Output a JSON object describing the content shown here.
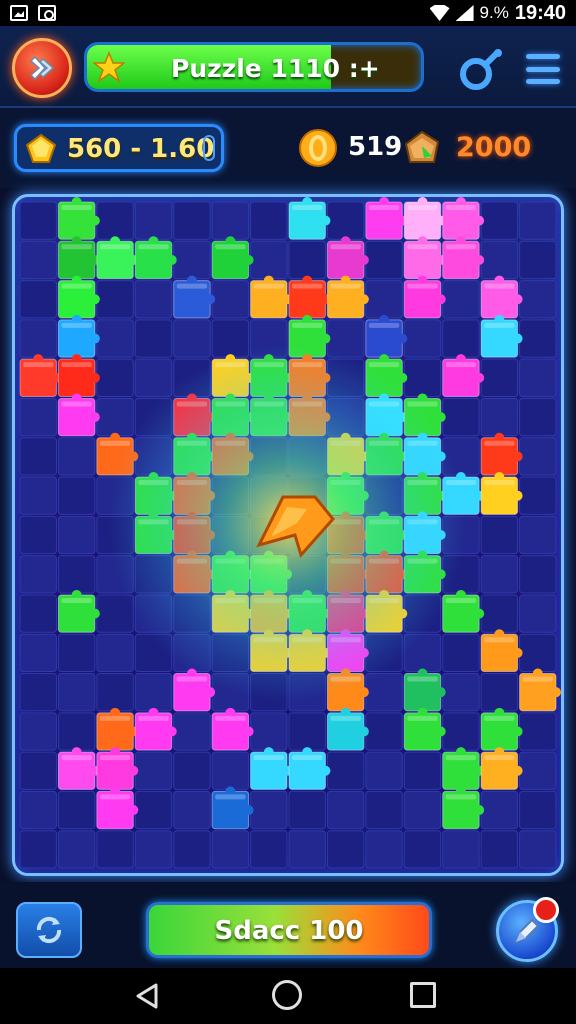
{
  "status_bar": {
    "battery_text": "9.%",
    "time": "19:40",
    "icons": [
      "photo-notification-icon",
      "app-notification-icon",
      "wifi-icon",
      "signal-icon"
    ]
  },
  "top_bar": {
    "level_title": "Puzzle 1110 :+",
    "level_progress": 0.73,
    "icons": [
      "close-icon",
      "star-icon",
      "gender-icon",
      "menu-icon"
    ]
  },
  "currency": {
    "gems_text": "560 - 1.60",
    "coins_text": "519",
    "chest_text": "2000",
    "icons": [
      "gem-icon",
      "coin-icon",
      "chest-icon"
    ]
  },
  "board": {
    "cols": 14,
    "rows": 17,
    "center_icon": "arrow-icon",
    "pieces": [
      [
        1,
        0,
        "#35e23a"
      ],
      [
        7,
        0,
        "#2fe0f0"
      ],
      [
        9,
        0,
        "#ff3df0"
      ],
      [
        10,
        0,
        "#ffb0f8"
      ],
      [
        11,
        0,
        "#ff5ae8"
      ],
      [
        1,
        1,
        "#22c433"
      ],
      [
        2,
        1,
        "#3af25a"
      ],
      [
        3,
        1,
        "#27e04a"
      ],
      [
        5,
        1,
        "#1fd23a"
      ],
      [
        8,
        1,
        "#e83ad0"
      ],
      [
        10,
        1,
        "#ff6ae8"
      ],
      [
        11,
        1,
        "#ff4ae0"
      ],
      [
        1,
        2,
        "#2af03a"
      ],
      [
        4,
        2,
        "#2b5bd8"
      ],
      [
        6,
        2,
        "#ffb020"
      ],
      [
        7,
        2,
        "#ff3a1a"
      ],
      [
        8,
        2,
        "#ffb020"
      ],
      [
        10,
        2,
        "#ff3ae0"
      ],
      [
        12,
        2,
        "#ff5ae8"
      ],
      [
        1,
        3,
        "#1fa8ff"
      ],
      [
        7,
        3,
        "#2fe03a"
      ],
      [
        9,
        3,
        "#2a4ad0"
      ],
      [
        12,
        3,
        "#35d8ff"
      ],
      [
        0,
        4,
        "#ff3a2a"
      ],
      [
        1,
        4,
        "#ff2a1a"
      ],
      [
        5,
        4,
        "#ffd020"
      ],
      [
        6,
        4,
        "#2fe03a"
      ],
      [
        7,
        4,
        "#ff7a1a"
      ],
      [
        9,
        4,
        "#2fe03a"
      ],
      [
        11,
        4,
        "#ff3ae0"
      ],
      [
        1,
        5,
        "#ff3af0"
      ],
      [
        4,
        5,
        "#ff2a3a"
      ],
      [
        5,
        5,
        "#2fe03a"
      ],
      [
        6,
        5,
        "#2fe03a"
      ],
      [
        7,
        5,
        "#ff7a1a"
      ],
      [
        9,
        5,
        "#35e0ff"
      ],
      [
        10,
        5,
        "#2fe03a"
      ],
      [
        2,
        6,
        "#ff6a1a"
      ],
      [
        4,
        6,
        "#2fe03a"
      ],
      [
        5,
        6,
        "#ff5a1a"
      ],
      [
        8,
        6,
        "#ffd020"
      ],
      [
        9,
        6,
        "#2fe03a"
      ],
      [
        10,
        6,
        "#35d8ff"
      ],
      [
        12,
        6,
        "#ff3a1a"
      ],
      [
        3,
        7,
        "#2fe03a"
      ],
      [
        4,
        7,
        "#ff5a1a"
      ],
      [
        8,
        7,
        "#2fe03a"
      ],
      [
        10,
        7,
        "#2fe03a"
      ],
      [
        11,
        7,
        "#35d8ff"
      ],
      [
        12,
        7,
        "#ffd020"
      ],
      [
        3,
        8,
        "#2fe03a"
      ],
      [
        4,
        8,
        "#ff3a1a"
      ],
      [
        8,
        8,
        "#ff3a1a"
      ],
      [
        9,
        8,
        "#2fe03a"
      ],
      [
        10,
        8,
        "#35d8ff"
      ],
      [
        4,
        9,
        "#ff5a1a"
      ],
      [
        5,
        9,
        "#2fe03a"
      ],
      [
        6,
        9,
        "#2fe03a"
      ],
      [
        8,
        9,
        "#ff3a1a"
      ],
      [
        9,
        9,
        "#ff4a1a"
      ],
      [
        10,
        9,
        "#2fe03a"
      ],
      [
        1,
        10,
        "#2fe03a"
      ],
      [
        5,
        10,
        "#ffd020"
      ],
      [
        6,
        10,
        "#ffb020"
      ],
      [
        7,
        10,
        "#2fe03a"
      ],
      [
        8,
        10,
        "#ff2a7a"
      ],
      [
        9,
        10,
        "#ffd020"
      ],
      [
        11,
        10,
        "#2fe03a"
      ],
      [
        6,
        11,
        "#ffd020"
      ],
      [
        7,
        11,
        "#ffd020"
      ],
      [
        8,
        11,
        "#ff3af0"
      ],
      [
        12,
        11,
        "#ff9a1a"
      ],
      [
        4,
        12,
        "#ff3af0"
      ],
      [
        8,
        12,
        "#ff8a1a"
      ],
      [
        10,
        12,
        "#20c060"
      ],
      [
        13,
        12,
        "#ffa020"
      ],
      [
        2,
        13,
        "#ff6a1a"
      ],
      [
        3,
        13,
        "#ff3af0"
      ],
      [
        5,
        13,
        "#ff3af0"
      ],
      [
        8,
        13,
        "#20d0e0"
      ],
      [
        10,
        13,
        "#2fe03a"
      ],
      [
        12,
        13,
        "#2fe03a"
      ],
      [
        1,
        14,
        "#ff4af0"
      ],
      [
        2,
        14,
        "#ff3ae0"
      ],
      [
        6,
        14,
        "#35d8ff"
      ],
      [
        7,
        14,
        "#35d8ff"
      ],
      [
        11,
        14,
        "#2fe03a"
      ],
      [
        12,
        14,
        "#ffb020"
      ],
      [
        2,
        15,
        "#ff3af0"
      ],
      [
        5,
        15,
        "#1a6ad8"
      ],
      [
        11,
        15,
        "#2fe03a"
      ]
    ]
  },
  "bottom": {
    "score_text": "Sdacc 100",
    "icons": [
      "refresh-icon",
      "hint-icon"
    ]
  },
  "nav": {
    "icons": [
      "back-icon",
      "home-icon",
      "recent-apps-icon"
    ]
  }
}
